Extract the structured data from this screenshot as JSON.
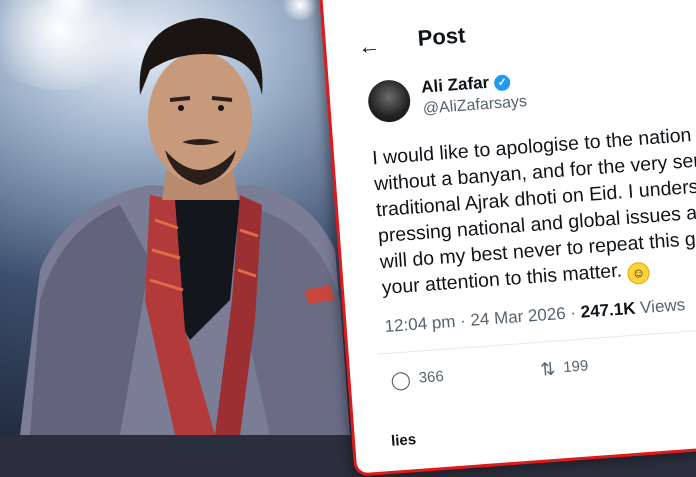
{
  "header": {
    "back_icon": "arrow-left-icon",
    "title": "Post"
  },
  "author": {
    "name": "Ali Zafar",
    "handle": "@AliZafarsays",
    "verified_icon": "verified-badge-icon",
    "verified_color": "#1d9bf0"
  },
  "tweet": {
    "lines": [
      "I would like to apologise to the nation f",
      "without a banyan, and for the very ser",
      "traditional Ajrak dhoti on Eid. I unders",
      "pressing national and global issues at",
      "will do my best never to repeat this g",
      "your attention to this matter."
    ],
    "emoji": "innocent-face-emoji"
  },
  "meta": {
    "time": "12:04 pm",
    "date": "24 Mar 2026",
    "views": "247.1K",
    "views_label": "Views"
  },
  "actions": {
    "replies": "366",
    "reposts": "199"
  },
  "footer_fragment": "lies",
  "colors": {
    "border": "#e0191b",
    "text": "#0f1419",
    "muted": "#536471"
  }
}
